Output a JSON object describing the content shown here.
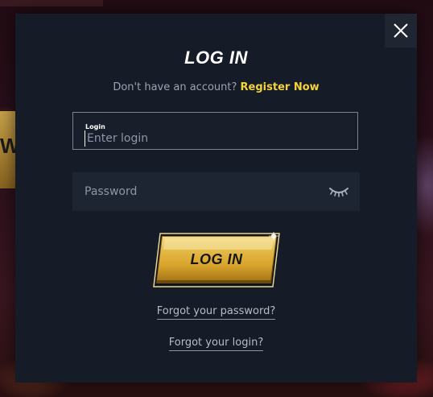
{
  "modal": {
    "title": "LOG IN",
    "subtitle_prefix": "Don't have an account?",
    "register_link": "Register Now",
    "close_icon": "close-icon"
  },
  "login": {
    "label": "Login",
    "placeholder": "Enter login",
    "value": ""
  },
  "password": {
    "placeholder": "Password",
    "value": "",
    "toggle_icon": "eye-closed-icon"
  },
  "submit": {
    "label": "LOG IN"
  },
  "links": {
    "forgot_password": "Forgot your password?",
    "forgot_login": "Forgot your login?"
  },
  "colors": {
    "accent": "#f4d23c",
    "modal_bg": "#161c27",
    "button_gold": "#d9ac38"
  }
}
